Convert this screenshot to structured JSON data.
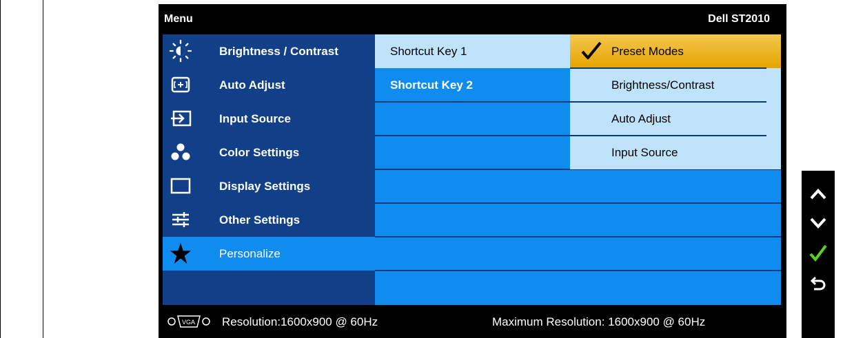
{
  "header": {
    "menu_label": "Menu",
    "model": "Dell ST2010"
  },
  "menu": {
    "items": [
      {
        "label": "Brightness / Contrast",
        "icon": "brightness-icon"
      },
      {
        "label": "Auto Adjust",
        "icon": "auto-adjust-icon"
      },
      {
        "label": "Input Source",
        "icon": "input-source-icon"
      },
      {
        "label": "Color Settings",
        "icon": "color-settings-icon"
      },
      {
        "label": "Display Settings",
        "icon": "display-settings-icon"
      },
      {
        "label": "Other Settings",
        "icon": "other-settings-icon"
      },
      {
        "label": "Personalize",
        "icon": "star-icon",
        "selected": true
      }
    ]
  },
  "submenu": {
    "items": [
      {
        "label": "Shortcut Key 1",
        "active": true
      },
      {
        "label": "Shortcut Key 2",
        "active": false
      }
    ]
  },
  "options": {
    "items": [
      {
        "label": "Preset Modes",
        "highlight": true,
        "checked": true
      },
      {
        "label": "Brightness/Contrast"
      },
      {
        "label": "Auto Adjust"
      },
      {
        "label": "Input Source"
      }
    ]
  },
  "footer": {
    "resolution": "Resolution:1600x900 @ 60Hz",
    "max_resolution": "Maximum Resolution: 1600x900 @ 60Hz",
    "icon": "vga-connector-icon"
  },
  "buttons": [
    {
      "name": "up-button",
      "icon": "chevron-up-icon"
    },
    {
      "name": "down-button",
      "icon": "chevron-down-icon"
    },
    {
      "name": "ok-button",
      "icon": "checkmark-icon"
    },
    {
      "name": "back-button",
      "icon": "back-arrow-icon"
    }
  ],
  "colors": {
    "menu_bg": "#113f88",
    "accent_blue": "#0f8cf0",
    "light_blue": "#bfe3fb",
    "highlight_orange": "#e7a400",
    "check_green": "#5ad11a"
  }
}
